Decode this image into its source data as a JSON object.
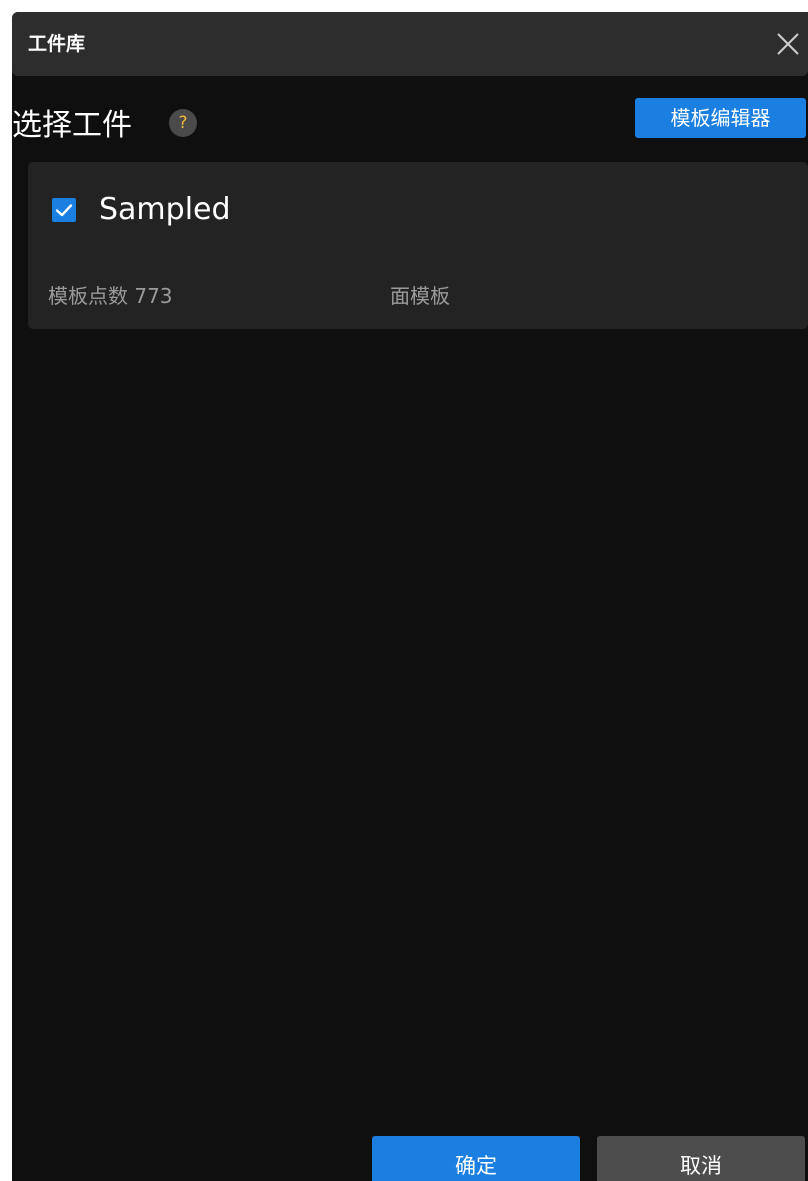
{
  "dialog": {
    "title": "工件库",
    "close_icon": "close-icon"
  },
  "section": {
    "title": "选择工件",
    "help_label": "?",
    "editor_button_label": "模板编辑器"
  },
  "workpiece": {
    "checked": true,
    "name": "Sampled",
    "points_label": "模板点数 773",
    "type_label": "面模板"
  },
  "footer": {
    "ok_label": "确定",
    "cancel_label": "取消"
  },
  "colors": {
    "accent": "#1a7fe0",
    "background": "#0f0f0f",
    "titlebar": "#2d2d2d",
    "card": "#232323",
    "help_icon_fg": "#f3b83b",
    "cancel_button": "#4d4d4d",
    "muted_text": "#9a9a9a"
  }
}
